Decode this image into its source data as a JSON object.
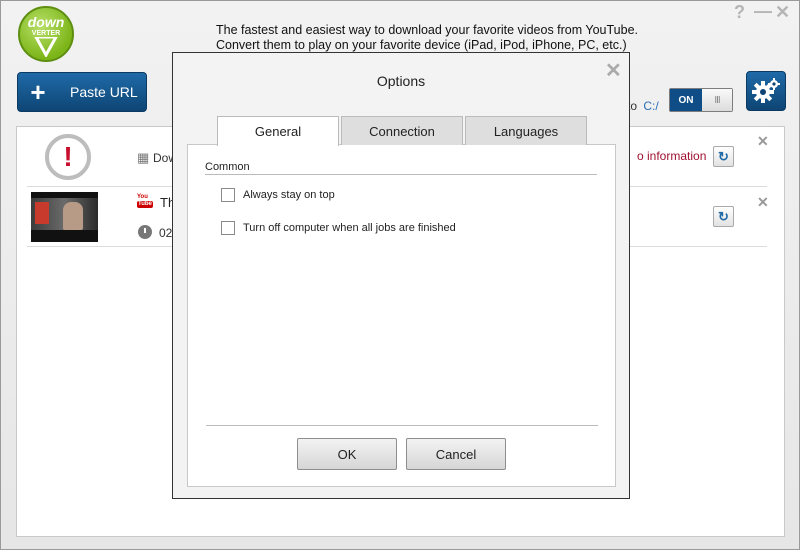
{
  "app": {
    "logo_top": "down",
    "logo_bottom": "VERTER",
    "tagline_line1": "The fastest and easiest way to download your favorite videos from YouTube.",
    "tagline_line2": "Convert them to play on your favorite device (iPad, iPod, iPhone, PC, etc.)",
    "window_controls": {
      "help": "?",
      "minimize": "—",
      "close": "✕"
    },
    "paste_button_label": "Paste URL",
    "save_to_suffix": "to",
    "save_to_path": "C:/",
    "toggle_label": "ON",
    "toggle_grip": "III",
    "icons": {
      "paste": "plus-icon",
      "settings": "gear-icon",
      "refresh": "refresh-icon",
      "remove": "close-icon"
    },
    "accent_color": "#0f4d86"
  },
  "list": {
    "rows": [
      {
        "text_fragment": "Dow",
        "status": "o information",
        "icon": "error-icon"
      },
      {
        "title_fragment": "Th",
        "time_fragment": "02",
        "source_icon": "youtube-icon"
      }
    ]
  },
  "dialog": {
    "title": "Options",
    "close": "✕",
    "tabs": [
      {
        "label": "General",
        "active": true
      },
      {
        "label": "Connection",
        "active": false
      },
      {
        "label": "Languages",
        "active": false
      }
    ],
    "group_label": "Common",
    "options": [
      {
        "label": "Always stay on top",
        "checked": false
      },
      {
        "label": "Turn off computer when all jobs are finished",
        "checked": false
      }
    ],
    "ok_label": "OK",
    "cancel_label": "Cancel"
  }
}
